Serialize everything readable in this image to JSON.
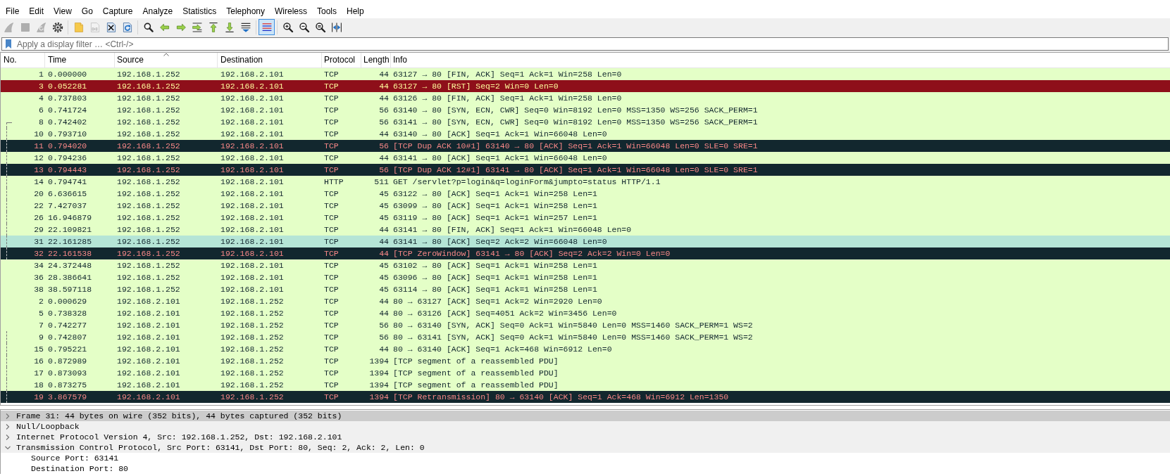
{
  "menu": [
    "File",
    "Edit",
    "View",
    "Go",
    "Capture",
    "Analyze",
    "Statistics",
    "Telephony",
    "Wireless",
    "Tools",
    "Help"
  ],
  "toolbar": [
    [
      {
        "kind": "fin",
        "disabled": true
      },
      {
        "kind": "stop",
        "disabled": true
      },
      {
        "kind": "fin-restart",
        "disabled": true
      },
      {
        "kind": "gear",
        "disabled": false
      }
    ],
    [
      {
        "kind": "open",
        "disabled": false
      },
      {
        "kind": "save",
        "disabled": true
      },
      {
        "kind": "close",
        "disabled": false
      },
      {
        "kind": "reload",
        "disabled": false
      }
    ],
    [
      {
        "kind": "find",
        "disabled": false
      },
      {
        "kind": "back",
        "disabled": false
      },
      {
        "kind": "forward",
        "disabled": false
      },
      {
        "kind": "goto",
        "disabled": false
      },
      {
        "kind": "first",
        "disabled": false
      },
      {
        "kind": "last",
        "disabled": false
      },
      {
        "kind": "autoscroll",
        "disabled": false
      }
    ],
    [
      {
        "kind": "colorize",
        "disabled": false,
        "checked": true
      }
    ],
    [
      {
        "kind": "zoom-in",
        "disabled": false
      },
      {
        "kind": "zoom-out",
        "disabled": false
      },
      {
        "kind": "zoom-reset",
        "disabled": false
      },
      {
        "kind": "resize-columns",
        "disabled": false
      }
    ]
  ],
  "filter": {
    "placeholder": "Apply a display filter … <Ctrl-/>"
  },
  "packet_list": {
    "columns": [
      {
        "label": "No.",
        "sorted": false
      },
      {
        "label": "Time",
        "sorted": false
      },
      {
        "label": "Source",
        "sorted": true
      },
      {
        "label": "Destination",
        "sorted": false
      },
      {
        "label": "Protocol",
        "sorted": false
      },
      {
        "label": "Length",
        "sorted": false
      },
      {
        "label": "Info",
        "sorted": false
      }
    ],
    "rows": [
      {
        "cells": [
          "1",
          "0.000000",
          "192.168.1.252",
          "192.168.2.101",
          "TCP",
          "44",
          "63127 → 80 [FIN, ACK] Seq=1 Ack=1 Win=258 Len=0"
        ],
        "kind": "normal",
        "selected": false,
        "related": false
      },
      {
        "cells": [
          "3",
          "0.052281",
          "192.168.1.252",
          "192.168.2.101",
          "TCP",
          "44",
          "63127 → 80 [RST] Seq=2 Win=0 Len=0"
        ],
        "kind": "reset",
        "selected": false,
        "related": false
      },
      {
        "cells": [
          "4",
          "0.737803",
          "192.168.1.252",
          "192.168.2.101",
          "TCP",
          "44",
          "63126 → 80 [FIN, ACK] Seq=1 Ack=1 Win=258 Len=0"
        ],
        "kind": "normal",
        "selected": false,
        "related": false
      },
      {
        "cells": [
          "6",
          "0.741724",
          "192.168.1.252",
          "192.168.2.101",
          "TCP",
          "56",
          "63140 → 80 [SYN, ECN, CWR] Seq=0 Win=8192 Len=0 MSS=1350 WS=256 SACK_PERM=1"
        ],
        "kind": "normal",
        "selected": false,
        "related": false
      },
      {
        "cells": [
          "8",
          "0.742402",
          "192.168.1.252",
          "192.168.2.101",
          "TCP",
          "56",
          "63141 → 80 [SYN, ECN, CWR] Seq=0 Win=8192 Len=0 MSS=1350 WS=256 SACK_PERM=1"
        ],
        "kind": "normal",
        "selected": false,
        "related": true
      },
      {
        "cells": [
          "10",
          "0.793710",
          "192.168.1.252",
          "192.168.2.101",
          "TCP",
          "44",
          "63140 → 80 [ACK] Seq=1 Ack=1 Win=66048 Len=0"
        ],
        "kind": "normal",
        "selected": false,
        "related": true
      },
      {
        "cells": [
          "11",
          "0.794020",
          "192.168.1.252",
          "192.168.2.101",
          "TCP",
          "56",
          "[TCP Dup ACK 10#1] 63140 → 80 [ACK] Seq=1 Ack=1 Win=66048 Len=0 SLE=0 SRE=1"
        ],
        "kind": "error",
        "selected": false,
        "related": true
      },
      {
        "cells": [
          "12",
          "0.794236",
          "192.168.1.252",
          "192.168.2.101",
          "TCP",
          "44",
          "63141 → 80 [ACK] Seq=1 Ack=1 Win=66048 Len=0"
        ],
        "kind": "normal",
        "selected": false,
        "related": true
      },
      {
        "cells": [
          "13",
          "0.794443",
          "192.168.1.252",
          "192.168.2.101",
          "TCP",
          "56",
          "[TCP Dup ACK 12#1] 63141 → 80 [ACK] Seq=1 Ack=1 Win=66048 Len=0 SLE=0 SRE=1"
        ],
        "kind": "error",
        "selected": false,
        "related": true
      },
      {
        "cells": [
          "14",
          "0.794741",
          "192.168.1.252",
          "192.168.2.101",
          "HTTP",
          "511",
          "GET /servlet?p=login&q=loginForm&jumpto=status HTTP/1.1"
        ],
        "kind": "normal",
        "selected": false,
        "related": true
      },
      {
        "cells": [
          "20",
          "6.636615",
          "192.168.1.252",
          "192.168.2.101",
          "TCP",
          "45",
          "63122 → 80 [ACK] Seq=1 Ack=1 Win=258 Len=1"
        ],
        "kind": "normal",
        "selected": false,
        "related": true
      },
      {
        "cells": [
          "22",
          "7.427037",
          "192.168.1.252",
          "192.168.2.101",
          "TCP",
          "45",
          "63099 → 80 [ACK] Seq=1 Ack=1 Win=258 Len=1"
        ],
        "kind": "normal",
        "selected": false,
        "related": true
      },
      {
        "cells": [
          "26",
          "16.946879",
          "192.168.1.252",
          "192.168.2.101",
          "TCP",
          "45",
          "63119 → 80 [ACK] Seq=1 Ack=1 Win=257 Len=1"
        ],
        "kind": "normal",
        "selected": false,
        "related": true
      },
      {
        "cells": [
          "29",
          "22.109821",
          "192.168.1.252",
          "192.168.2.101",
          "TCP",
          "44",
          "63141 → 80 [FIN, ACK] Seq=1 Ack=1 Win=66048 Len=0"
        ],
        "kind": "normal",
        "selected": false,
        "related": true
      },
      {
        "cells": [
          "31",
          "22.161285",
          "192.168.1.252",
          "192.168.2.101",
          "TCP",
          "44",
          "63141 → 80 [ACK] Seq=2 Ack=2 Win=66048 Len=0"
        ],
        "kind": "normal",
        "selected": true,
        "related": true
      },
      {
        "cells": [
          "32",
          "22.161538",
          "192.168.1.252",
          "192.168.2.101",
          "TCP",
          "44",
          "[TCP ZeroWindow] 63141 → 80 [ACK] Seq=2 Ack=2 Win=0 Len=0"
        ],
        "kind": "error",
        "selected": false,
        "related": true
      },
      {
        "cells": [
          "34",
          "24.372448",
          "192.168.1.252",
          "192.168.2.101",
          "TCP",
          "45",
          "63102 → 80 [ACK] Seq=1 Ack=1 Win=258 Len=1"
        ],
        "kind": "normal",
        "selected": false,
        "related": false
      },
      {
        "cells": [
          "36",
          "28.386641",
          "192.168.1.252",
          "192.168.2.101",
          "TCP",
          "45",
          "63096 → 80 [ACK] Seq=1 Ack=1 Win=258 Len=1"
        ],
        "kind": "normal",
        "selected": false,
        "related": false
      },
      {
        "cells": [
          "38",
          "38.597118",
          "192.168.1.252",
          "192.168.2.101",
          "TCP",
          "45",
          "63114 → 80 [ACK] Seq=1 Ack=1 Win=258 Len=1"
        ],
        "kind": "normal",
        "selected": false,
        "related": false
      },
      {
        "cells": [
          "2",
          "0.000629",
          "192.168.2.101",
          "192.168.1.252",
          "TCP",
          "44",
          "80 → 63127 [ACK] Seq=1 Ack=2 Win=2920 Len=0"
        ],
        "kind": "normal",
        "selected": false,
        "related": false
      },
      {
        "cells": [
          "5",
          "0.738328",
          "192.168.2.101",
          "192.168.1.252",
          "TCP",
          "44",
          "80 → 63126 [ACK] Seq=4051 Ack=2 Win=3456 Len=0"
        ],
        "kind": "normal",
        "selected": false,
        "related": false
      },
      {
        "cells": [
          "7",
          "0.742277",
          "192.168.2.101",
          "192.168.1.252",
          "TCP",
          "56",
          "80 → 63140 [SYN, ACK] Seq=0 Ack=1 Win=5840 Len=0 MSS=1460 SACK_PERM=1 WS=2"
        ],
        "kind": "normal",
        "selected": false,
        "related": false
      },
      {
        "cells": [
          "9",
          "0.742807",
          "192.168.2.101",
          "192.168.1.252",
          "TCP",
          "56",
          "80 → 63141 [SYN, ACK] Seq=0 Ack=1 Win=5840 Len=0 MSS=1460 SACK_PERM=1 WS=2"
        ],
        "kind": "normal",
        "selected": false,
        "related": true
      },
      {
        "cells": [
          "15",
          "0.795221",
          "192.168.2.101",
          "192.168.1.252",
          "TCP",
          "44",
          "80 → 63140 [ACK] Seq=1 Ack=468 Win=6912 Len=0"
        ],
        "kind": "normal",
        "selected": false,
        "related": true
      },
      {
        "cells": [
          "16",
          "0.872989",
          "192.168.2.101",
          "192.168.1.252",
          "TCP",
          "1394",
          "[TCP segment of a reassembled PDU]"
        ],
        "kind": "normal",
        "selected": false,
        "related": true
      },
      {
        "cells": [
          "17",
          "0.873093",
          "192.168.2.101",
          "192.168.1.252",
          "TCP",
          "1394",
          "[TCP segment of a reassembled PDU]"
        ],
        "kind": "normal",
        "selected": false,
        "related": true
      },
      {
        "cells": [
          "18",
          "0.873275",
          "192.168.2.101",
          "192.168.1.252",
          "TCP",
          "1394",
          "[TCP segment of a reassembled PDU]"
        ],
        "kind": "normal",
        "selected": false,
        "related": true
      },
      {
        "cells": [
          "19",
          "3.867579",
          "192.168.2.101",
          "192.168.1.252",
          "TCP",
          "1394",
          "[TCP Retransmission] 80 → 63140 [ACK] Seq=1 Ack=468 Win=6912 Len=1350"
        ],
        "kind": "error",
        "selected": false,
        "related": true
      }
    ]
  },
  "details": {
    "items": [
      {
        "label": "Frame 31: 44 bytes on wire (352 bits), 44 bytes captured (352 bits)",
        "expanded": false,
        "selected": true
      },
      {
        "label": "Null/Loopback",
        "expanded": false,
        "selected": false
      },
      {
        "label": "Internet Protocol Version 4, Src: 192.168.1.252, Dst: 192.168.2.101",
        "expanded": false,
        "selected": false
      },
      {
        "label": "Transmission Control Protocol, Src Port: 63141, Dst Port: 80, Seq: 2, Ack: 2, Len: 0",
        "expanded": true,
        "selected": false,
        "children": [
          {
            "label": "Source Port: 63141",
            "selected": false
          },
          {
            "label": "Destination Port: 80",
            "selected": false
          }
        ]
      }
    ]
  }
}
